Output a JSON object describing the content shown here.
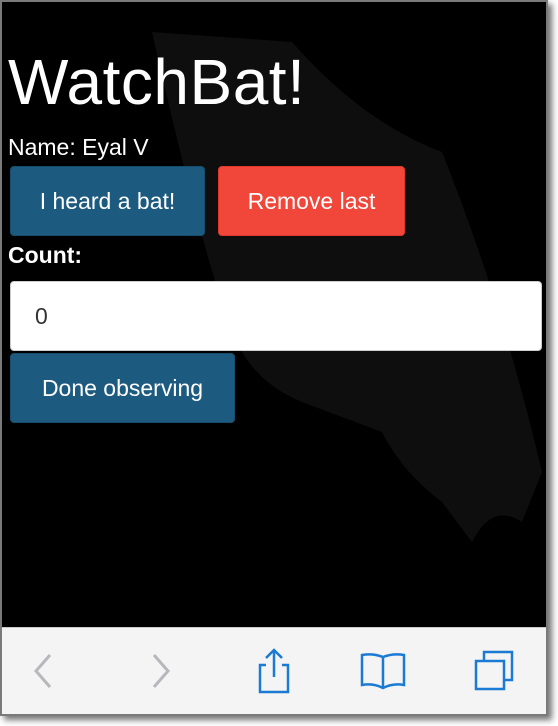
{
  "app": {
    "title": "WatchBat!"
  },
  "observer": {
    "name_line": "Name: Eyal V"
  },
  "actions": {
    "heard_label": "I heard a bat!",
    "remove_label": "Remove last",
    "done_label": "Done observing"
  },
  "counter": {
    "label": "Count:",
    "value": "0"
  },
  "browser_toolbar": {
    "buttons": [
      {
        "icon": "back-icon",
        "enabled": false
      },
      {
        "icon": "forward-icon",
        "enabled": false
      },
      {
        "icon": "share-icon",
        "enabled": true
      },
      {
        "icon": "bookmarks-icon",
        "enabled": true
      },
      {
        "icon": "tabs-icon",
        "enabled": true
      }
    ]
  },
  "colors": {
    "background": "#000000",
    "primary_button": "#1c5a80",
    "danger_button": "#f0473a",
    "toolbar_tint": "#1a7ad4",
    "toolbar_disabled": "#b8b8bc"
  }
}
